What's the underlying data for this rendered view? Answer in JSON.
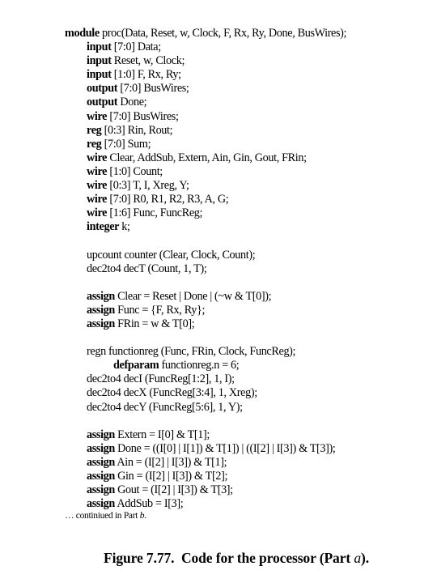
{
  "code": {
    "lines": [
      {
        "kw": "module",
        "rest": " proc(Data, Reset, w, Clock, F, Rx, Ry, Done, BusWires);"
      },
      {
        "kw": "input",
        "rest": " [7:0] Data;"
      },
      {
        "kw": "input",
        "rest": " Reset, w, Clock;"
      },
      {
        "kw": "input",
        "rest": " [1:0] F, Rx, Ry;"
      },
      {
        "kw": "output",
        "rest": " [7:0] BusWires;"
      },
      {
        "kw": "output",
        "rest": " Done;"
      },
      {
        "kw": "wire",
        "rest": " [7:0] BusWires;"
      },
      {
        "kw": "reg",
        "rest": " [0:3] Rin, Rout;"
      },
      {
        "kw": "reg",
        "rest": " [7:0] Sum;"
      },
      {
        "kw": "wire",
        "rest": " Clear, AddSub, Extern, Ain, Gin, Gout, FRin;"
      },
      {
        "kw": "wire",
        "rest": " [1:0] Count;"
      },
      {
        "kw": "wire",
        "rest": " [0:3] T, I, Xreg, Y;"
      },
      {
        "kw": "wire",
        "rest": " [7:0] R0, R1, R2, R3, A, G;"
      },
      {
        "kw": "wire",
        "rest": " [1:6] Func, FuncReg;"
      },
      {
        "kw": "integer",
        "rest": " k;"
      },
      {
        "kw": "",
        "rest": ""
      },
      {
        "kw": "",
        "rest": "upcount counter (Clear, Clock, Count);"
      },
      {
        "kw": "",
        "rest": "dec2to4 decT (Count, 1, T);"
      },
      {
        "kw": "",
        "rest": ""
      },
      {
        "kw": "assign",
        "rest": " Clear = Reset | Done | (~w & T[0]);"
      },
      {
        "kw": "assign",
        "rest": " Func = {F, Rx, Ry};"
      },
      {
        "kw": "assign",
        "rest": " FRin = w & T[0];"
      },
      {
        "kw": "",
        "rest": ""
      },
      {
        "kw": "",
        "rest": "regn functionreg (Func, FRin, Clock, FuncReg);"
      },
      {
        "kw": "defparam",
        "rest": " functionreg.n = 6;"
      },
      {
        "kw": "",
        "rest": "dec2to4 decI (FuncReg[1:2], 1, I);"
      },
      {
        "kw": "",
        "rest": "dec2to4 decX (FuncReg[3:4], 1, Xreg);"
      },
      {
        "kw": "",
        "rest": "dec2to4 decY (FuncReg[5:6], 1, Y);"
      },
      {
        "kw": "",
        "rest": ""
      },
      {
        "kw": "assign",
        "rest": " Extern = I[0] & T[1];"
      },
      {
        "kw": "assign",
        "rest": " Done = ((I[0] | I[1]) & T[1]) | ((I[2] | I[3]) & T[3]);"
      },
      {
        "kw": "assign",
        "rest": " Ain = (I[2] | I[3]) & T[1];"
      },
      {
        "kw": "assign",
        "rest": " Gin = (I[2] | I[3]) & T[2];"
      },
      {
        "kw": "assign",
        "rest": " Gout = (I[2] | I[3]) & T[3];"
      },
      {
        "kw": "assign",
        "rest": " AddSub = I[3];"
      }
    ]
  },
  "continuation": {
    "prefix": "… continiued in Part ",
    "part": "b",
    "suffix": "."
  },
  "caption": {
    "prefix": "Figure 7.77.  Code for the processor (Part ",
    "part": "a",
    "suffix": ")."
  }
}
